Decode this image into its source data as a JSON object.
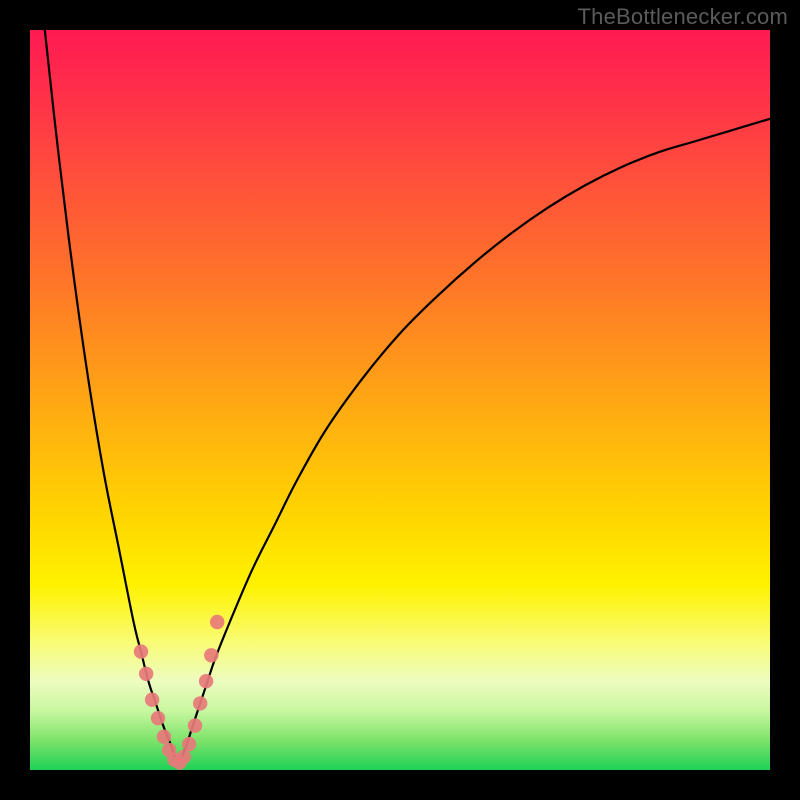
{
  "source_label": "TheBottlenecker.com",
  "colors": {
    "frame": "#000000",
    "curve_stroke": "#000000",
    "marker_fill": "#e77a7a",
    "marker_stroke": "#d86060",
    "gradient_top": "#ff1a52",
    "gradient_bottom": "#1fd157"
  },
  "chart_data": {
    "type": "line",
    "title": "",
    "xlabel": "",
    "ylabel": "",
    "xlim": [
      0,
      100
    ],
    "ylim": [
      0,
      100
    ],
    "x_at_min": 20,
    "series": [
      {
        "name": "curve",
        "x": [
          0,
          2,
          4,
          6,
          8,
          10,
          12,
          14,
          15,
          16,
          17,
          18,
          19,
          20,
          21,
          22,
          23,
          24,
          25,
          27,
          30,
          33,
          36,
          40,
          45,
          50,
          55,
          60,
          65,
          70,
          75,
          80,
          85,
          90,
          95,
          100
        ],
        "values": [
          120,
          100,
          82,
          66,
          52,
          40,
          30,
          20,
          16,
          12,
          9,
          6,
          3.5,
          1,
          3,
          6,
          9,
          12,
          15,
          20,
          27,
          33,
          39,
          46,
          53,
          59,
          64,
          68.5,
          72.5,
          76,
          79,
          81.5,
          83.5,
          85,
          86.5,
          88
        ]
      }
    ],
    "markers": {
      "name": "highlighted-points",
      "x": [
        15,
        15.7,
        16.5,
        17.3,
        18.1,
        18.8,
        19.5,
        20.2,
        20.8,
        21.5,
        22.3,
        23,
        23.8,
        24.5,
        25.3
      ],
      "values": [
        16,
        13,
        9.5,
        7,
        4.5,
        2.7,
        1.4,
        1,
        1.8,
        3.5,
        6,
        9,
        12,
        15.5,
        20
      ]
    }
  }
}
